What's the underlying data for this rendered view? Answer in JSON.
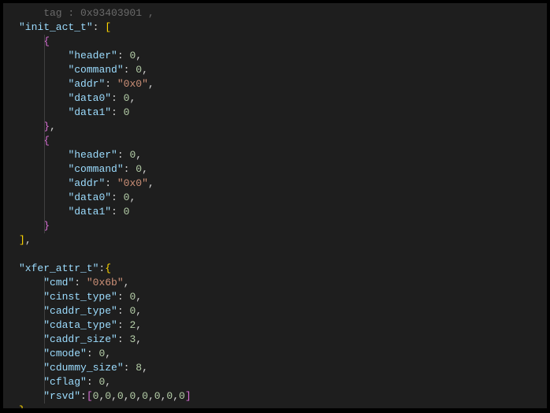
{
  "truncated_top": "    tag : 0x93403901 ,",
  "init_act_t": {
    "key": "\"init_act_t\"",
    "items": [
      {
        "header": {
          "k": "\"header\"",
          "v": "0"
        },
        "command": {
          "k": "\"command\"",
          "v": "0"
        },
        "addr": {
          "k": "\"addr\"",
          "v": "\"0x0\""
        },
        "data0": {
          "k": "\"data0\"",
          "v": "0"
        },
        "data1": {
          "k": "\"data1\"",
          "v": "0"
        }
      },
      {
        "header": {
          "k": "\"header\"",
          "v": "0"
        },
        "command": {
          "k": "\"command\"",
          "v": "0"
        },
        "addr": {
          "k": "\"addr\"",
          "v": "\"0x0\""
        },
        "data0": {
          "k": "\"data0\"",
          "v": "0"
        },
        "data1": {
          "k": "\"data1\"",
          "v": "0"
        }
      }
    ]
  },
  "xfer_attr_t": {
    "key": "\"xfer_attr_t\"",
    "cmd": {
      "k": "\"cmd\"",
      "v": "\"0x6b\""
    },
    "cinst_type": {
      "k": "\"cinst_type\"",
      "v": "0"
    },
    "caddr_type": {
      "k": "\"caddr_type\"",
      "v": "0"
    },
    "cdata_type": {
      "k": "\"cdata_type\"",
      "v": "2"
    },
    "caddr_size": {
      "k": "\"caddr_size\"",
      "v": "3"
    },
    "cmode": {
      "k": "\"cmode\"",
      "v": "0"
    },
    "cdummy_size": {
      "k": "\"cdummy_size\"",
      "v": "8"
    },
    "cflag": {
      "k": "\"cflag\"",
      "v": "0"
    },
    "rsvd": {
      "k": "\"rsvd\"",
      "v": "[0,0,0,0,0,0,0,0]"
    }
  }
}
